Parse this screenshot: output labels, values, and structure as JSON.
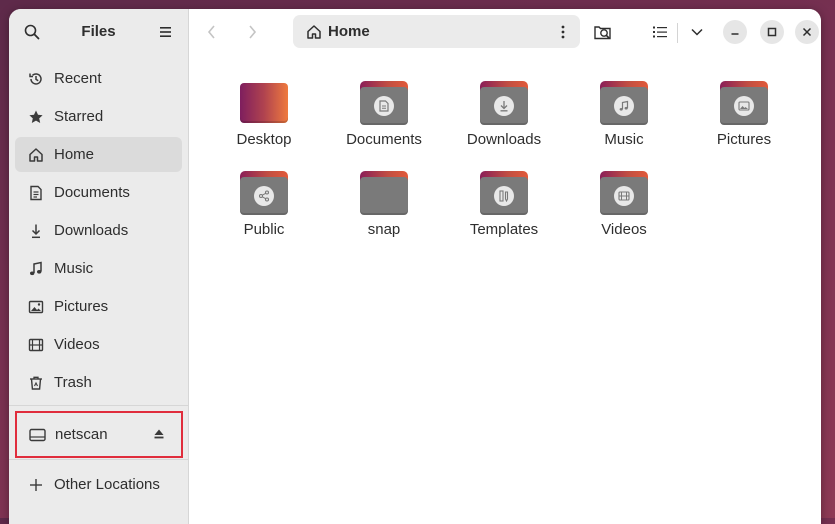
{
  "sidebar": {
    "title": "Files",
    "items": [
      {
        "label": "Recent",
        "icon": "clock-icon"
      },
      {
        "label": "Starred",
        "icon": "star-icon"
      },
      {
        "label": "Home",
        "icon": "home-icon",
        "active": true
      },
      {
        "label": "Documents",
        "icon": "document-icon"
      },
      {
        "label": "Downloads",
        "icon": "download-icon"
      },
      {
        "label": "Music",
        "icon": "music-note-icon"
      },
      {
        "label": "Pictures",
        "icon": "picture-icon"
      },
      {
        "label": "Videos",
        "icon": "film-icon"
      },
      {
        "label": "Trash",
        "icon": "trash-icon"
      }
    ],
    "drive": {
      "label": "netscan",
      "icon": "drive-icon"
    },
    "other_locations": "Other Locations"
  },
  "pathbar": {
    "label": "Home",
    "icon": "home-icon"
  },
  "files": [
    {
      "name": "Desktop"
    },
    {
      "name": "Documents",
      "emblem": "document-icon"
    },
    {
      "name": "Downloads",
      "emblem": "download-icon"
    },
    {
      "name": "Music",
      "emblem": "music-note-icon"
    },
    {
      "name": "Pictures",
      "emblem": "picture-icon"
    },
    {
      "name": "Public",
      "emblem": "share-icon"
    },
    {
      "name": "snap"
    },
    {
      "name": "Templates",
      "emblem": "template-icon"
    },
    {
      "name": "Videos",
      "emblem": "film-icon"
    }
  ],
  "colors": {
    "accent_highlight": "#e02d3c",
    "folder_tab": "#c24f42",
    "folder_body": "#7a7a7a",
    "sidebar_bg": "#ebebeb"
  }
}
